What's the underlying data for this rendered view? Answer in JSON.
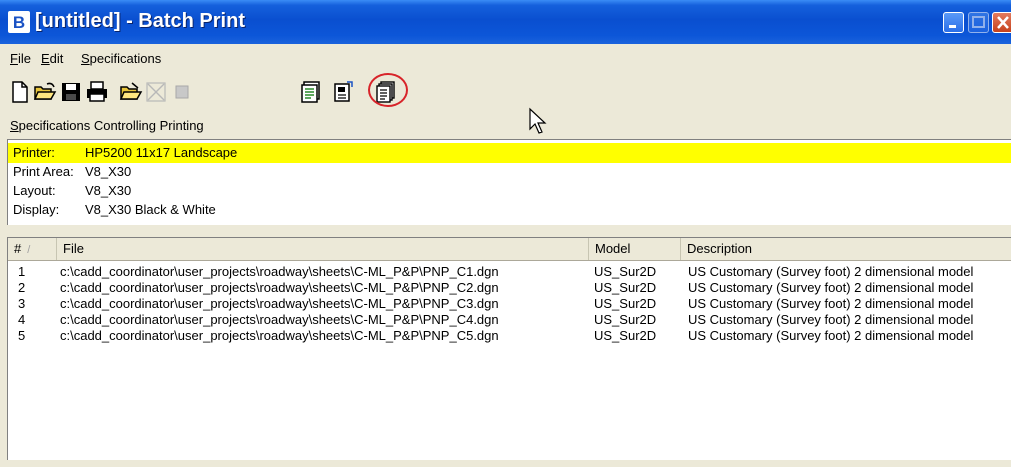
{
  "window": {
    "title": "[untitled] - Batch Print"
  },
  "menu": [
    {
      "label": "File",
      "accel": "F"
    },
    {
      "label": "Edit",
      "accel": "E"
    },
    {
      "label": "Specifications",
      "accel": "S"
    }
  ],
  "toolbar": {
    "icons": [
      "new-document-icon",
      "open-folder-icon",
      "save-icon",
      "print-icon",
      "open-specification-icon",
      "delete-icon",
      "disabled-square-icon",
      "print-preview-icon",
      "properties-icon",
      "batch-print-icon"
    ],
    "highlighted": "batch-print-icon",
    "annotation_color": "#d8242a"
  },
  "specs_section": {
    "label": "Specifications Controlling Printing",
    "accel": "S",
    "rows": [
      {
        "key": "Printer:",
        "value": "HP5200 11x17 Landscape",
        "highlighted": true
      },
      {
        "key": "Print Area:",
        "value": "V8_X30"
      },
      {
        "key": "Layout:",
        "value": "V8_X30"
      },
      {
        "key": "Display:",
        "value": "V8_X30 Black & White"
      }
    ],
    "highlight_color": "#ffff00"
  },
  "file_list": {
    "columns": [
      {
        "label": "#",
        "sort_mark": "/"
      },
      {
        "label": "File"
      },
      {
        "label": "Model"
      },
      {
        "label": "Description"
      }
    ],
    "rows": [
      {
        "num": "1",
        "file": "c:\\cadd_coordinator\\user_projects\\roadway\\sheets\\C-ML_P&P\\PNP_C1.dgn",
        "model": "US_Sur2D",
        "description": "US Customary (Survey foot) 2 dimensional model"
      },
      {
        "num": "2",
        "file": "c:\\cadd_coordinator\\user_projects\\roadway\\sheets\\C-ML_P&P\\PNP_C2.dgn",
        "model": "US_Sur2D",
        "description": "US Customary (Survey foot) 2 dimensional model"
      },
      {
        "num": "3",
        "file": "c:\\cadd_coordinator\\user_projects\\roadway\\sheets\\C-ML_P&P\\PNP_C3.dgn",
        "model": "US_Sur2D",
        "description": "US Customary (Survey foot) 2 dimensional model"
      },
      {
        "num": "4",
        "file": "c:\\cadd_coordinator\\user_projects\\roadway\\sheets\\C-ML_P&P\\PNP_C4.dgn",
        "model": "US_Sur2D",
        "description": "US Customary (Survey foot) 2 dimensional model"
      },
      {
        "num": "5",
        "file": "c:\\cadd_coordinator\\user_projects\\roadway\\sheets\\C-ML_P&P\\PNP_C5.dgn",
        "model": "US_Sur2D",
        "description": "US Customary (Survey foot) 2 dimensional model"
      }
    ]
  }
}
